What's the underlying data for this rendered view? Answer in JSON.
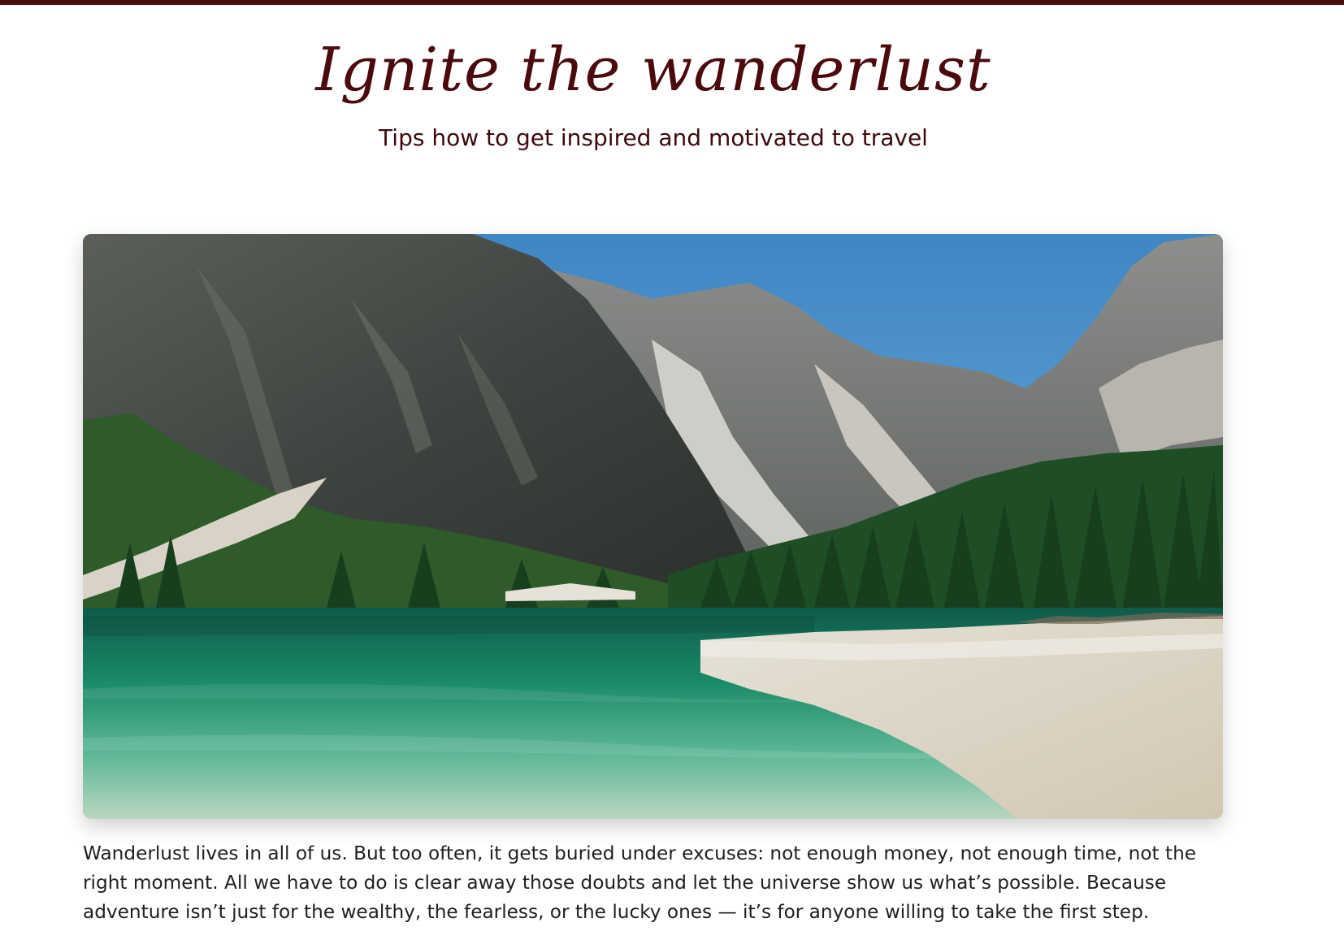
{
  "header": {
    "title": "Ignite the wanderlust",
    "subtitle": "Tips how to get inspired and motivated to travel"
  },
  "hero_image": {
    "icon": "mountain-lake-photo"
  },
  "article": {
    "intro": "Wanderlust lives in all of us. But too often, it gets buried under excuses: not enough money, not enough time, not the right moment. All we have to do is clear away those doubts and let the universe show us what’s possible. Because adventure isn’t just for the wealthy, the fearless, or the lucky ones — it’s for anyone willing to take the first step."
  },
  "colors": {
    "accent": "#4a0a0e",
    "text": "#1f1f1f"
  }
}
